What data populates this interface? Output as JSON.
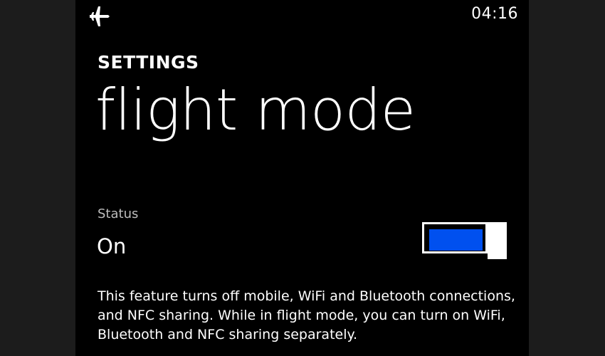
{
  "status_bar": {
    "icon": "airplane-icon",
    "time": "04:16"
  },
  "header": {
    "section": "SETTINGS",
    "title": "flight mode"
  },
  "status": {
    "caption": "Status",
    "value": "On",
    "toggle_on": true,
    "accent_color": "#0050ef"
  },
  "description": "This feature turns off mobile, WiFi and Bluetooth connections, and NFC sharing. While in flight mode, you can turn on WiFi, Bluetooth and NFC sharing separately."
}
